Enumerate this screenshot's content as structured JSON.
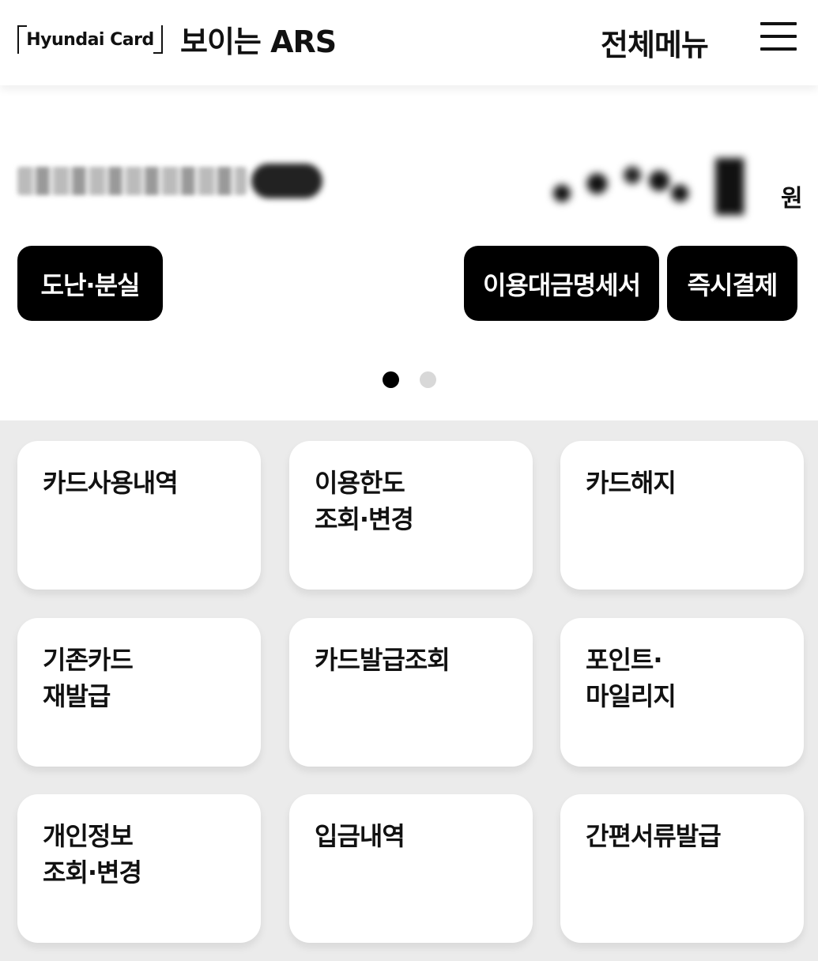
{
  "header": {
    "logo_text": "Hyundai Card",
    "title": "보이는 ARS",
    "menu_label": "전체메뉴",
    "menu_icon": "hamburger-icon"
  },
  "summary": {
    "currency_unit": "원",
    "buttons": {
      "theft_loss": "도난·분실",
      "statement": "이용대금명세서",
      "instant_pay": "즉시결제"
    },
    "carousel": {
      "pages": 2,
      "active": 1
    }
  },
  "tiles": [
    "카드사용내역",
    "이용한도\n조회·변경",
    "카드해지",
    "기존카드\n재발급",
    "카드발급조회",
    "포인트·\n마일리지",
    "개인정보\n조회·변경",
    "입금내역",
    "간편서류발급"
  ],
  "colors": {
    "button_bg": "#000000",
    "grid_bg": "#ebebeb",
    "dot_inactive": "#d8d8d8"
  }
}
